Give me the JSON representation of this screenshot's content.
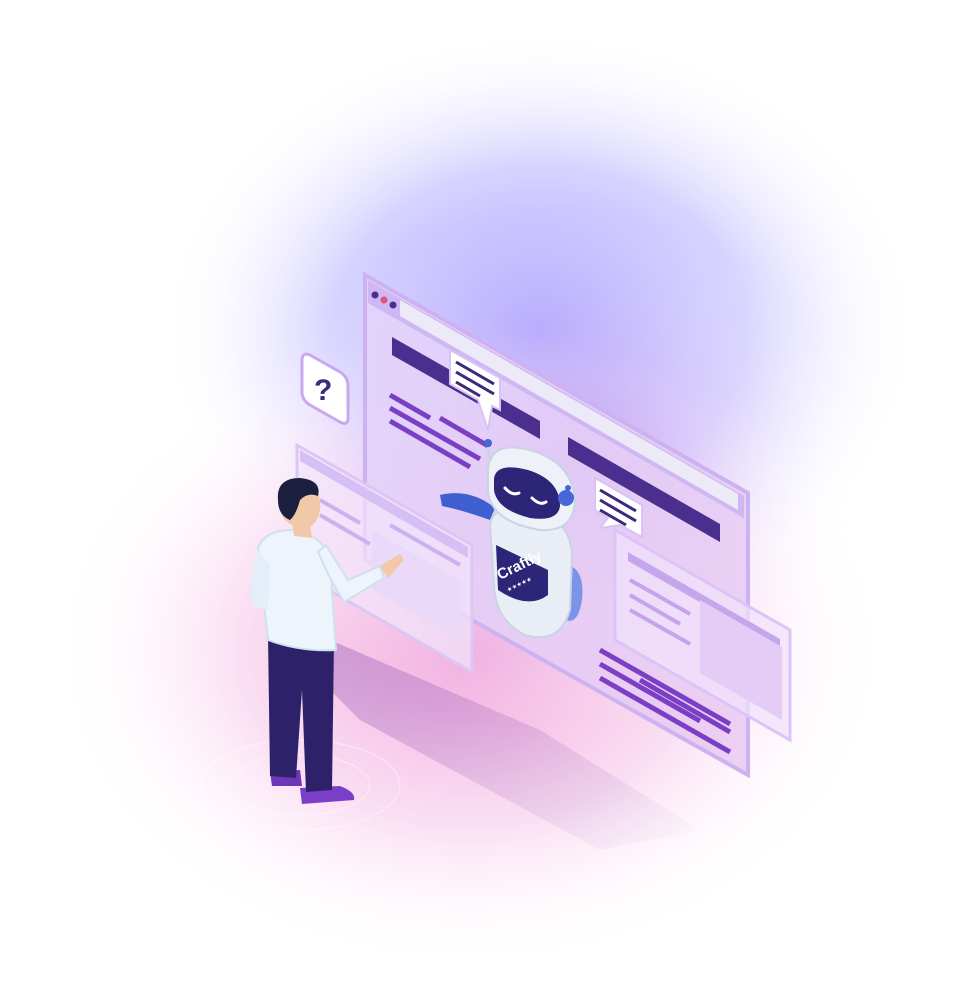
{
  "robot": {
    "chest_label": "Craftly",
    "chest_stars": "★★★★★"
  },
  "question_card": {
    "glyph": "?"
  },
  "colors": {
    "glow_blue": "#a9a2ff",
    "glow_pink": "#f3a6dc",
    "panel_fill": "#d9c6f5",
    "panel_frame": "#c8aaf0",
    "accent_bar": "#4b2f8f",
    "accent_line": "#7a3fc4",
    "robot_body": "#e9eef6",
    "robot_visor": "#2d2577",
    "shirt": "#eef4fb",
    "pants": "#2d2269",
    "shoes": "#7b3fc7"
  }
}
